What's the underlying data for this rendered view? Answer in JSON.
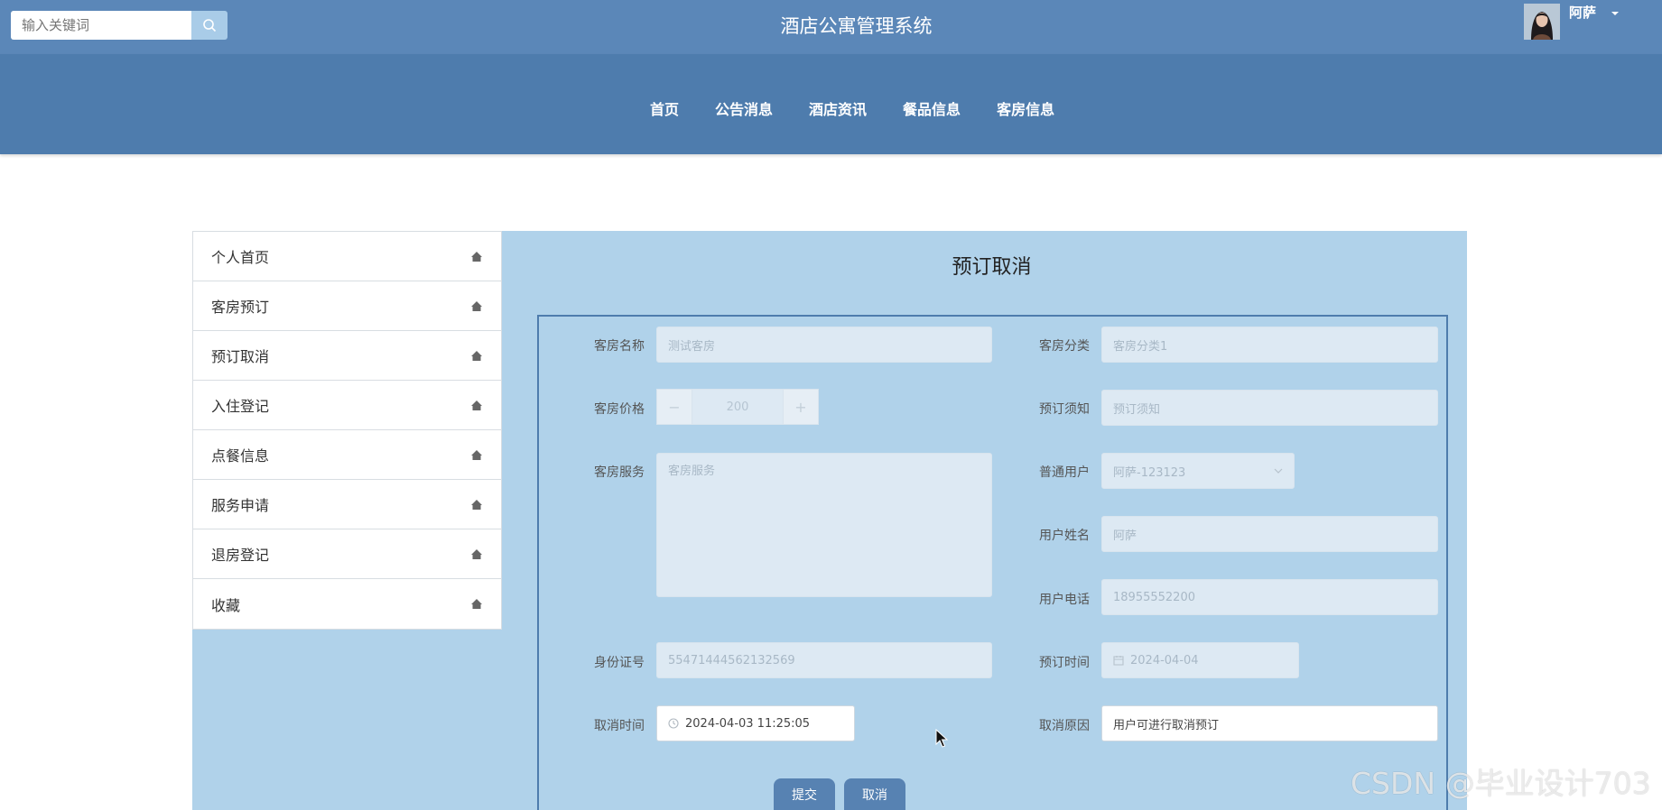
{
  "search": {
    "placeholder": "输入关键词"
  },
  "site_title": "酒店公寓管理系统",
  "user": {
    "name": "阿萨"
  },
  "nav": [
    "首页",
    "公告消息",
    "酒店资讯",
    "餐品信息",
    "客房信息"
  ],
  "sidebar": [
    "个人首页",
    "客房预订",
    "预订取消",
    "入住登记",
    "点餐信息",
    "服务申请",
    "退房登记",
    "收藏"
  ],
  "page_title": "预订取消",
  "form": {
    "room_name": {
      "label": "客房名称",
      "value": "测试客房"
    },
    "room_category": {
      "label": "客房分类",
      "value": "客房分类1"
    },
    "room_price": {
      "label": "客房价格",
      "value": "200"
    },
    "booking_notice": {
      "label": "预订须知",
      "value": "预订须知"
    },
    "room_service": {
      "label": "客房服务",
      "value": "客房服务"
    },
    "regular_user": {
      "label": "普通用户",
      "value": "阿萨-123123"
    },
    "user_name": {
      "label": "用户姓名",
      "value": "阿萨"
    },
    "user_phone": {
      "label": "用户电话",
      "value": "18955552200"
    },
    "id_number": {
      "label": "身份证号",
      "value": "55471444562132569"
    },
    "booking_time": {
      "label": "预订时间",
      "value": "2024-04-04"
    },
    "cancel_time": {
      "label": "取消时间",
      "value": "2024-04-03 11:25:05"
    },
    "cancel_reason": {
      "label": "取消原因",
      "value": "用户可进行取消预订"
    }
  },
  "buttons": {
    "submit": "提交",
    "cancel": "取消"
  },
  "watermark": "CSDN @毕业设计703"
}
